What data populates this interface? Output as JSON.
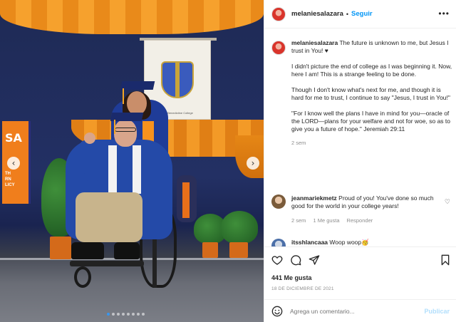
{
  "post": {
    "username": "melaniesalazara",
    "separator": "•",
    "follow_label": "Seguir",
    "more_label": "•••",
    "caption_paragraphs": [
      "The future is unknown to me, but Jesus I trust in You! ♥",
      "I didn't picture the end of college as I was beginning it. Now, here I am! This is a strange feeling to be done.",
      "Though I don't know what's next for me, and though it is hard for me to trust, I continue to say \"Jesus, I trust in You!\"",
      "\"For I know well the plans I have in mind for you—oracle of the LORD—plans for your welfare and not for woe, so as to give you a future of hope.\" Jeremiah 29:11"
    ],
    "caption_time": "2 sem",
    "likes": "441 Me gusta",
    "date": "18 DE DICIEMBRE DE 2021"
  },
  "comments": [
    {
      "username": "jeanmariekmetz",
      "text": "Proud of you! You've done so much good for the world in your college years!",
      "time": "2 sem",
      "likes": "1 Me gusta",
      "reply_label": "Responder"
    },
    {
      "username": "itsshlancaaa",
      "text": "Woop woop🥳"
    }
  ],
  "composer": {
    "placeholder": "Agrega un comentario...",
    "post_label": "Publicar"
  },
  "photo": {
    "banner_text": "The Benedictine College",
    "sign_text": "SA",
    "sign_subtext": "TH\nRN\nLICY",
    "slide_count": 8,
    "active_slide": 1
  },
  "icons": {
    "heart": "heart-icon",
    "comment": "comment-icon",
    "share": "share-icon",
    "save": "bookmark-icon",
    "emoji": "emoji-icon"
  },
  "colors": {
    "accent": "#0095f6",
    "post_disabled": "#b2dffc",
    "meta": "#8e8e8e"
  }
}
